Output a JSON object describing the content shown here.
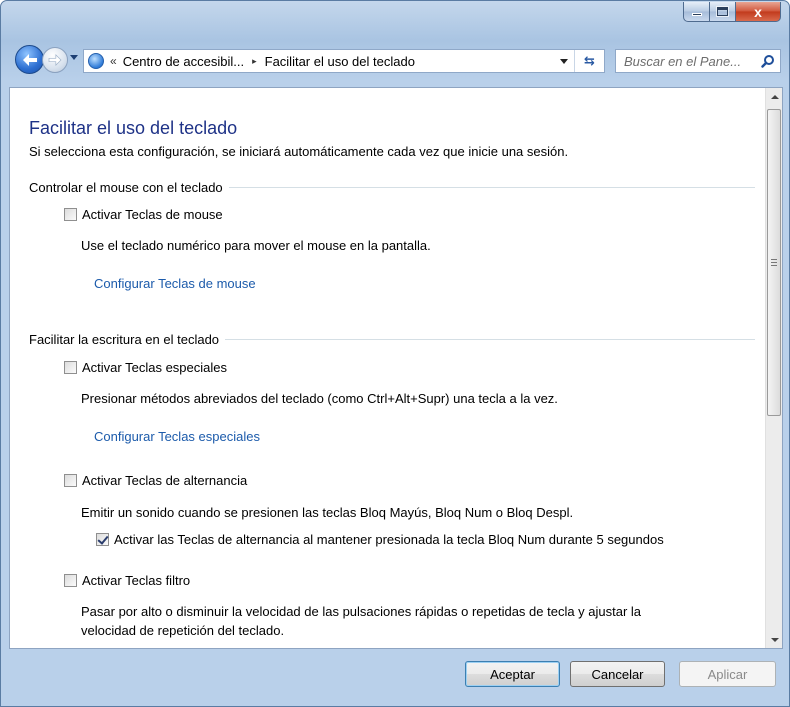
{
  "window": {
    "minimize_icon": "minimize-icon",
    "maximize_icon": "maximize-icon",
    "close_label": "x"
  },
  "navbar": {
    "back_icon": "back-arrow-icon",
    "forward_icon": "forward-arrow-icon",
    "breadcrumb_prefix": "«",
    "breadcrumbs": [
      "Centro de accesibil...",
      "Facilitar el uso del teclado"
    ],
    "separator": "▸",
    "refresh_icon": "refresh-icon",
    "search_placeholder": "Buscar en el Pane...",
    "search_icon": "search-icon"
  },
  "page": {
    "title": "Facilitar el uso del teclado",
    "subtitle": "Si selecciona esta configuración, se iniciará automáticamente cada vez que inicie una sesión.",
    "sections": [
      {
        "heading": "Controlar el mouse con el teclado",
        "options": [
          {
            "label": "Activar Teclas de mouse",
            "checked": false,
            "description": "Use el teclado numérico para mover el mouse en la pantalla.",
            "link": "Configurar Teclas de mouse"
          }
        ]
      },
      {
        "heading": "Facilitar la escritura en el teclado",
        "options": [
          {
            "label": "Activar Teclas especiales",
            "checked": false,
            "description": "Presionar métodos abreviados del teclado (como Ctrl+Alt+Supr) una tecla a la vez.",
            "link": "Configurar Teclas especiales"
          },
          {
            "label": "Activar Teclas de alternancia",
            "checked": false,
            "description": "Emitir un sonido cuando se presionen las teclas Bloq Mayús, Bloq Num o Bloq Despl.",
            "suboption": {
              "label": "Activar las Teclas de alternancia al mantener presionada la tecla Bloq Num durante 5 segundos",
              "checked": true
            }
          },
          {
            "label": "Activar Teclas filtro",
            "checked": false,
            "description_line1": "Pasar por alto o disminuir la velocidad de las pulsaciones rápidas o repetidas de tecla y ajustar la",
            "description_line2": "velocidad de repetición del teclado."
          }
        ]
      }
    ]
  },
  "buttons": {
    "ok": "Aceptar",
    "cancel": "Cancelar",
    "apply": "Aplicar"
  },
  "colors": {
    "title": "#1e3287",
    "link": "#1c5bab"
  }
}
